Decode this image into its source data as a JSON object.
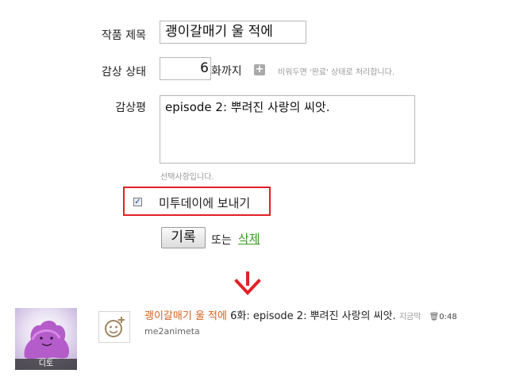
{
  "form": {
    "title_label": "작품 제목",
    "title_value": "괭이갈매기 울 적에",
    "status_label": "감상 상태",
    "episode_value": "6",
    "episode_suffix": "화까지",
    "plus_symbol": "+",
    "status_hint": "비워두면 '완료' 상태로 처리합니다.",
    "review_label": "감상평",
    "review_value": "episode 2: 뿌려진 사랑의 씨앗.",
    "optional_hint": "선택사항입니다.",
    "send_label": "미투데이에 보내기",
    "send_checked": true,
    "submit_label": "기록",
    "or_text": "또는",
    "delete_label": "삭제"
  },
  "arrow": {
    "color": "#e12126"
  },
  "post": {
    "avatar_caption": "디토",
    "title_link": "괭이갈매기 울 적에",
    "episode_text": "6화: episode 2: 뿌려진 사랑의 씨앗.",
    "time_text": "지금막",
    "trash_icon": "trash-icon",
    "comment_count": "0:48",
    "author": "me2animeta"
  },
  "colors": {
    "accent_red": "#e12126",
    "link_green": "#3a9a1f",
    "post_title_orange": "#d8611d"
  }
}
